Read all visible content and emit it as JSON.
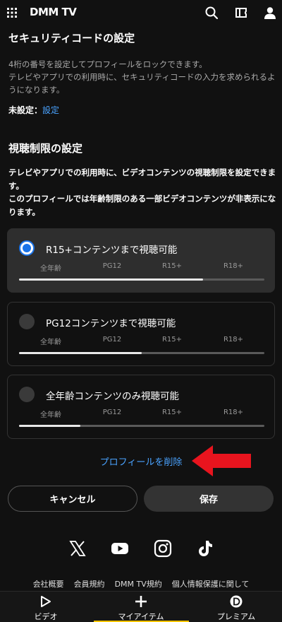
{
  "header": {
    "logo": "DMM TV",
    "icons": [
      "grid-menu-icon",
      "search-icon",
      "ticket-icon",
      "user-icon"
    ]
  },
  "security": {
    "title": "セキュリティコードの設定",
    "description_line1": "4桁の番号を設定してプロフィールをロックできます。",
    "description_line2": "テレビやアプリでの利用時に、セキュリティコードの入力を求められるようになります。",
    "status_label": "未設定：",
    "status_link": "設定"
  },
  "parental": {
    "title": "視聴制限の設定",
    "description_line1": "テレビやアプリでの利用時に、ビデオコンテンツの視聴制限を設定できます。",
    "description_line2": "このプロフィールでは年齢制限のある一部ビデオコンテンツが非表示になります。",
    "ticks": [
      "全年齢",
      "PG12",
      "R15+",
      "R18+"
    ],
    "options": [
      {
        "label": "R15+コンテンツまで視聴可能",
        "selected": true,
        "level": 0.75
      },
      {
        "label": "PG12コンテンツまで視聴可能",
        "selected": false,
        "level": 0.5
      },
      {
        "label": "全年齢コンテンツのみ視聴可能",
        "selected": false,
        "level": 0.25
      }
    ]
  },
  "actions": {
    "delete_profile": "プロフィールを削除",
    "cancel": "キャンセル",
    "save": "保存"
  },
  "social": [
    "x-icon",
    "youtube-icon",
    "instagram-icon",
    "tiktok-icon"
  ],
  "footer": {
    "links": [
      "会社概要",
      "会員規約",
      "DMM TV規約",
      "個人情報保護に関して"
    ]
  },
  "bottom_nav": {
    "items": [
      {
        "label": "ビデオ",
        "icon": "play-icon",
        "active": false
      },
      {
        "label": "マイアイテム",
        "icon": "plus-icon",
        "active": true
      },
      {
        "label": "プレミアム",
        "icon": "premium-icon",
        "active": false
      }
    ]
  },
  "colors": {
    "background": "#111111",
    "accent_blue": "#1a73e8",
    "link_blue": "#4aa3ff",
    "annotation_red": "#e8141e",
    "active_tab": "#f5c400"
  }
}
